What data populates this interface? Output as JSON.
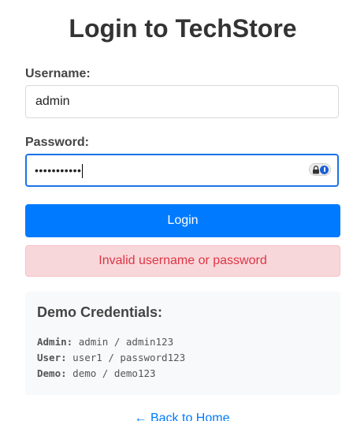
{
  "page": {
    "title": "Login to TechStore"
  },
  "form": {
    "username_label": "Username:",
    "username_value": "admin",
    "password_label": "Password:",
    "password_masked": "•••••••••••",
    "submit_label": "Login"
  },
  "error": {
    "message": "Invalid username or password"
  },
  "demo": {
    "title": "Demo Credentials:",
    "credentials": [
      {
        "key": "Admin:",
        "value": "admin / admin123"
      },
      {
        "key": "User:",
        "value": "user1 / password123"
      },
      {
        "key": "Demo:",
        "value": "demo / demo123"
      }
    ]
  },
  "footer": {
    "back_link": "← Back to Home"
  },
  "colors": {
    "primary": "#007bff",
    "error_text": "#dc3545",
    "error_bg": "#f8d7da",
    "focus_border": "#1a73e8",
    "demo_bg": "#f8f9fa"
  },
  "icons": {
    "password_manager": [
      "lock-icon",
      "password-key-icon"
    ]
  }
}
